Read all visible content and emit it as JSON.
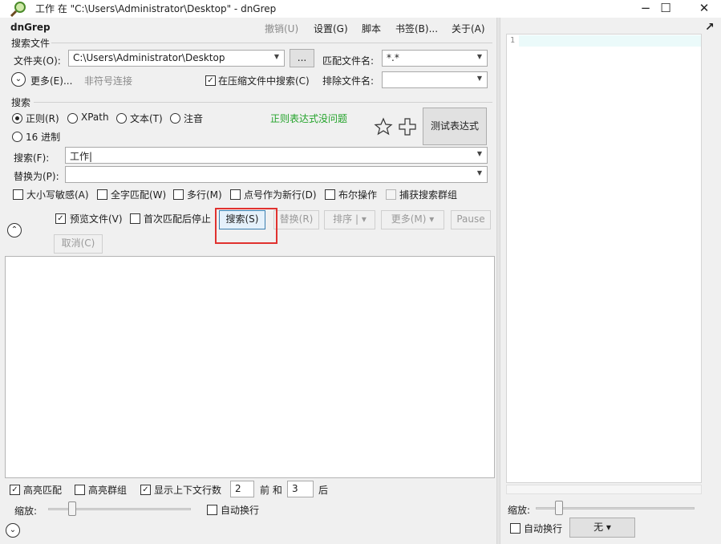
{
  "window": {
    "title": "工作 在 \"C:\\Users\\Administrator\\Desktop\" - dnGrep",
    "minimize": "−",
    "maximize": "☐",
    "close": "✕"
  },
  "menu": {
    "brand": "dnGrep",
    "undo": "撤销(U)",
    "settings": "设置(G)",
    "script": "脚本",
    "bookmarks": "书签(B)...",
    "about": "关于(A)"
  },
  "search_files": {
    "group_label": "搜索文件",
    "folder_label": "文件夹(O):",
    "folder_value": "C:\\Users\\Administrator\\Desktop",
    "browse_label": "...",
    "match_file_label": "匹配文件名:",
    "match_file_value": "*.*",
    "more_label": "更多(E)...",
    "non_symlink_label": "非符号连接",
    "search_archives_label": "在压缩文件中搜索(C)",
    "search_archives_checked": true,
    "exclude_label": "排除文件名:",
    "exclude_value": ""
  },
  "search": {
    "group_label": "搜索",
    "regex_label": "正则(R)",
    "xpath_label": "XPath",
    "text_label": "文本(T)",
    "phonetic_label": "注音",
    "hex_label": "16 进制",
    "selected_mode": "regex",
    "regex_status": "正则表达式没问题",
    "test_button": "测试表达式",
    "search_label": "搜索(F):",
    "search_value": "工作",
    "replace_label": "替换为(P):",
    "replace_value": "",
    "options": {
      "case_sensitive": "大小写敏感(A)",
      "whole_word": "全字匹配(W)",
      "multiline": "多行(M)",
      "dot_newline": "点号作为新行(D)",
      "boolean": "布尔操作",
      "capture_groups": "捕获搜索群组"
    }
  },
  "actions": {
    "preview_label": "预览文件(V)",
    "preview_checked": true,
    "stop_first_label": "首次匹配后停止",
    "stop_first_checked": false,
    "search_button": "搜索(S)",
    "replace_button": "替换(R)",
    "sort_button": "排序",
    "more_button": "更多(M)",
    "pause_button": "Pause",
    "cancel_button": "取消(C)"
  },
  "footer": {
    "highlight_matches": "高亮匹配",
    "highlight_matches_checked": true,
    "highlight_groups": "高亮群组",
    "highlight_groups_checked": false,
    "show_context": "显示上下文行数",
    "show_context_checked": true,
    "before_value": "2",
    "before_label": "前 和",
    "after_value": "3",
    "after_label": "后",
    "zoom_label": "缩放:",
    "word_wrap_label": "自动换行"
  },
  "preview": {
    "line_number": "1",
    "zoom_label": "缩放:",
    "word_wrap_label": "自动换行",
    "syntax_value": "无",
    "popout_glyph": "↗"
  },
  "colors": {
    "accent_highlight": "#e0322f",
    "status_ok": "#23a32a",
    "preview_line_bg": "#ebfafa"
  }
}
